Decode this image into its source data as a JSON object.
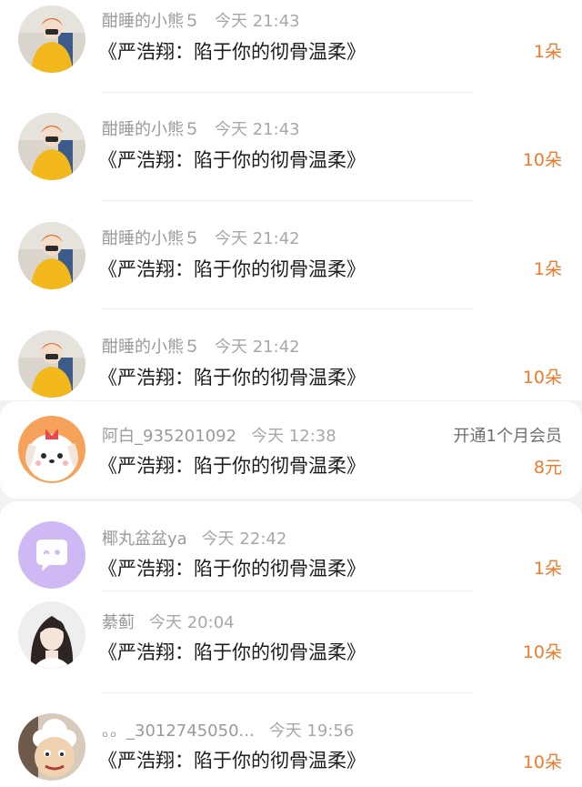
{
  "gifts": [
    {
      "name": "酣睡的小熊５",
      "time": "今天 21:43",
      "title": "《严浩翔：陷于你的彻骨温柔》",
      "amount": "1朵",
      "avatar": "girl-yellow-jacket-icon"
    },
    {
      "name": "酣睡的小熊５",
      "time": "今天 21:43",
      "title": "《严浩翔：陷于你的彻骨温柔》",
      "amount": "10朵",
      "avatar": "girl-yellow-jacket-icon"
    },
    {
      "name": "酣睡的小熊５",
      "time": "今天 21:42",
      "title": "《严浩翔：陷于你的彻骨温柔》",
      "amount": "1朵",
      "avatar": "girl-yellow-jacket-icon"
    },
    {
      "name": "酣睡的小熊５",
      "time": "今天 21:42",
      "title": "《严浩翔：陷于你的彻骨温柔》",
      "amount": "10朵",
      "avatar": "girl-yellow-jacket-icon"
    },
    {
      "name": "阿白_935201092",
      "time": "今天 12:38",
      "note": "开通1个月会员",
      "title": "《严浩翔：陷于你的彻骨温柔》",
      "amount": "8元",
      "avatar": "cartoon-dog-icon"
    },
    {
      "name": "椰丸盆盆ya",
      "time": "今天 22:42",
      "title": "《严浩翔：陷于你的彻骨温柔》",
      "amount": "1朵",
      "avatar": "chat-bubble-default-icon"
    },
    {
      "name": "綦蓟",
      "time": "今天 20:04",
      "title": "《严浩翔：陷于你的彻骨温柔》",
      "amount": "10朵",
      "avatar": "girl-portrait-icon"
    },
    {
      "name": "。。_3012745050...",
      "time": "今天 19:56",
      "title": "《严浩翔：陷于你的彻骨温柔》",
      "amount": "10朵",
      "avatar": "cartoon-sheep-icon"
    }
  ],
  "colors": {
    "amount": "#ee7a2a",
    "meta": "#9a9a9a",
    "title": "#1c1c1c",
    "bg": "#f2f2f2"
  }
}
